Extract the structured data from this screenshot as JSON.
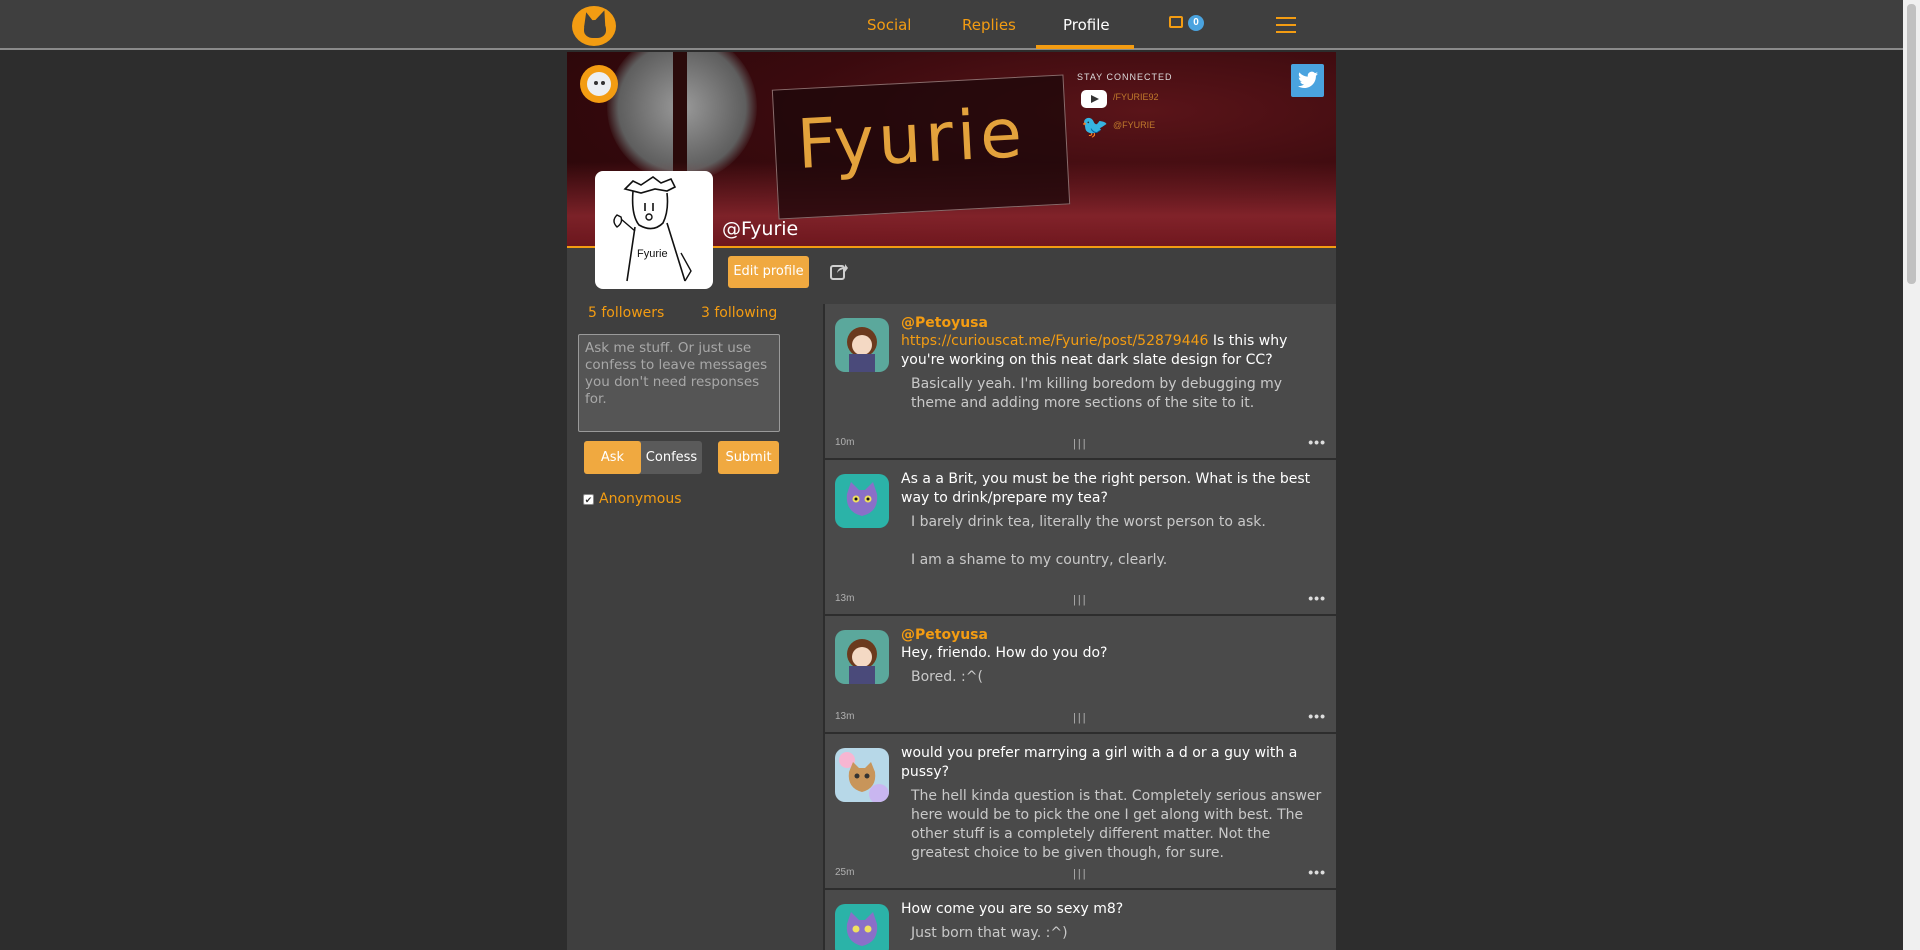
{
  "nav": {
    "social": "Social",
    "replies": "Replies",
    "profile": "Profile",
    "inbox_count": "0"
  },
  "profile": {
    "handle": "@Fyurie",
    "drawing_label": "Fyurie",
    "edit_label": "Edit profile",
    "followers": "5 followers",
    "following": "3 following"
  },
  "banner": {
    "title": "Fyurie",
    "stay_connected": "STAY CONNECTED",
    "youtube_handle": "/FYURIE92",
    "twitter_handle": "@FYURIE"
  },
  "ask": {
    "placeholder": "Ask me stuff. Or just use confess to leave messages you don't need responses for.",
    "tab_ask": "Ask",
    "tab_confess": "Confess",
    "submit": "Submit",
    "anonymous_label": "Anonymous",
    "anonymous_checked": true
  },
  "posts": [
    {
      "author": "@Petoyusa",
      "question_link": "https://curiouscat.me/Fyurie/post/52879446",
      "question": "Is this why you're working on this neat dark slate design for CC?",
      "answer": [
        "Basically yeah. I'm killing boredom by debugging my theme and adding more sections of the site to it."
      ],
      "time": "10m",
      "avatar": "girl"
    },
    {
      "author": "",
      "question_link": "",
      "question": "As a a Brit, you must be the right person. What is the best way to drink/prepare my tea?",
      "answer": [
        "I barely drink tea, literally the worst person to ask.",
        "I am a shame to my country, clearly."
      ],
      "time": "13m",
      "avatar": "cat-teal"
    },
    {
      "author": "@Petoyusa",
      "question_link": "",
      "question": "Hey, friendo. How do you do?",
      "answer": [
        "Bored. :^("
      ],
      "time": "13m",
      "avatar": "girl"
    },
    {
      "author": "",
      "question_link": "",
      "question": "would you prefer marrying a girl with a d or a guy with a pussy?",
      "answer": [
        "The hell kinda question is that. Completely serious answer here would be to pick the one I get along with best. The other stuff is a completely different matter. Not the greatest choice to be given though, for sure."
      ],
      "time": "25m",
      "avatar": "cat-pastel"
    },
    {
      "author": "",
      "question_link": "",
      "question": "How come you are so sexy m8?",
      "answer": [
        "Just born that way. :^)"
      ],
      "time": "",
      "avatar": "cat-teal"
    }
  ],
  "colors": {
    "accent": "#f39c12",
    "background": "#2d2d2d",
    "panel": "#3f3f3f",
    "post": "#4a4a4a",
    "twitter": "#4aa3df"
  },
  "icons": [
    "logo-cat-icon",
    "inbox-icon",
    "hamburger-menu-icon",
    "twitter-icon",
    "share-icon",
    "more-options-icon"
  ]
}
